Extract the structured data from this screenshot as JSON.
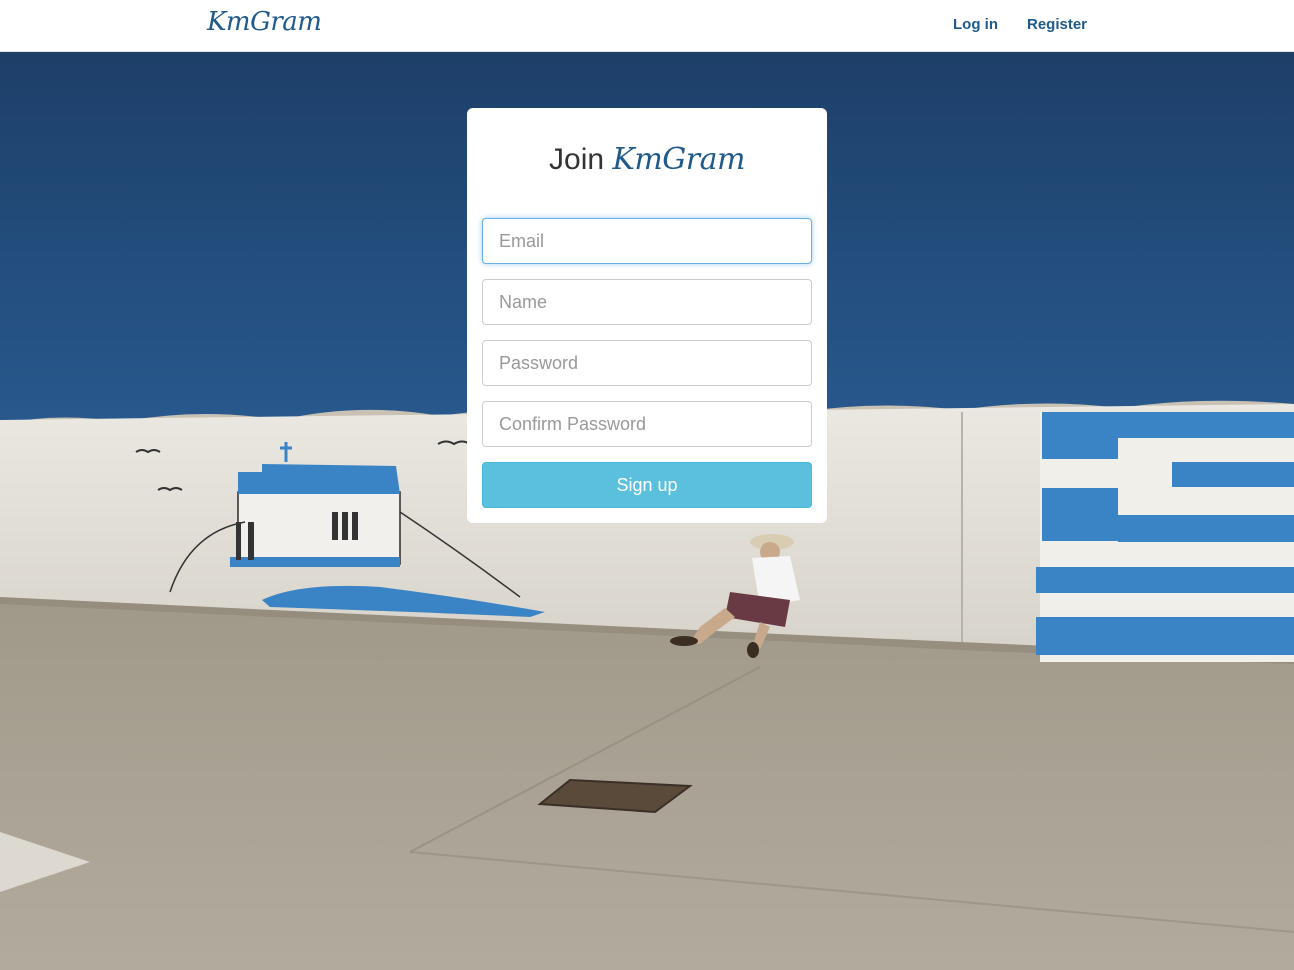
{
  "navbar": {
    "brand": "KmGram",
    "links": [
      {
        "label": "Log in"
      },
      {
        "label": "Register"
      }
    ]
  },
  "card": {
    "title_prefix": "Join",
    "title_brand": "KmGram",
    "fields": {
      "email": {
        "placeholder": "Email"
      },
      "name": {
        "placeholder": "Name"
      },
      "password": {
        "placeholder": "Password"
      },
      "confirm_password": {
        "placeholder": "Confirm Password"
      }
    },
    "submit_label": "Sign up"
  },
  "colors": {
    "brand": "#1f5a8a",
    "button": "#5bc0de",
    "sky": "#1d3f68",
    "wall": "#e6e3dc",
    "flag_blue": "#3a84c6"
  }
}
